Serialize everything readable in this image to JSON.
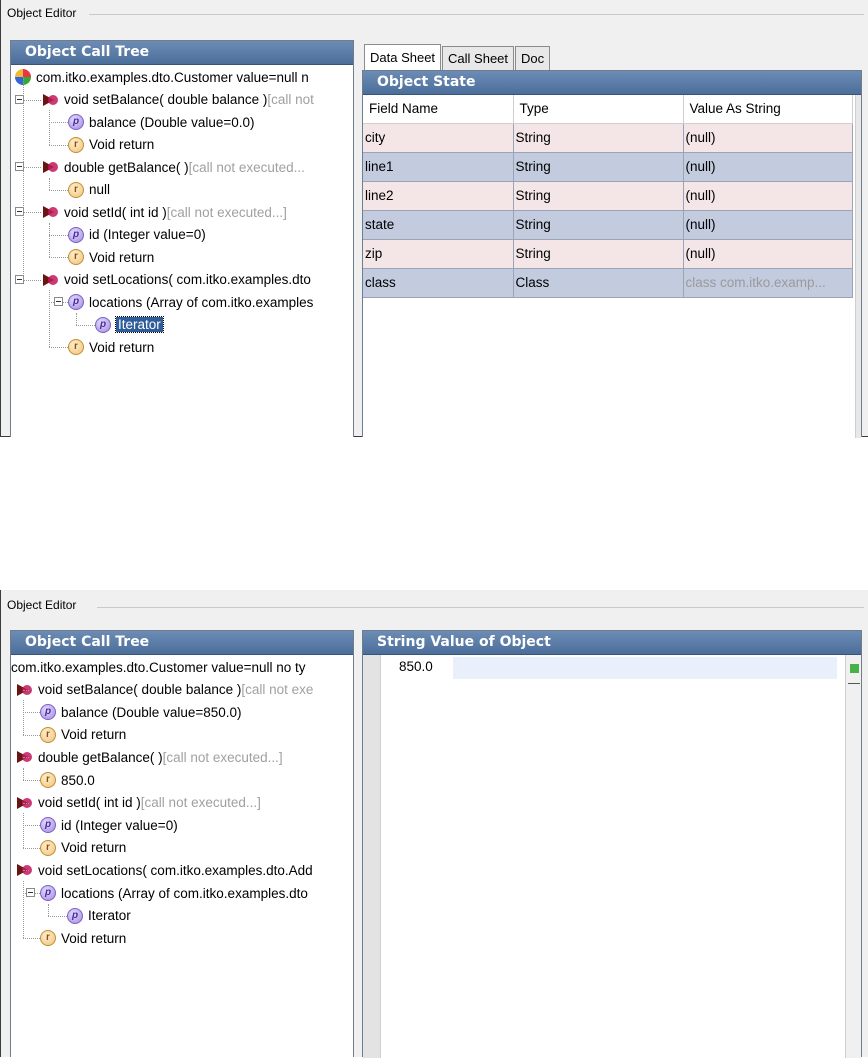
{
  "panel1": {
    "editor_title": "Object Editor",
    "tree_header": "Object Call Tree",
    "tree": [
      {
        "icon": "root",
        "text": "com.itko.examples.dto.Customer value=null n",
        "muted": ""
      },
      {
        "icon": "method",
        "text": "void setBalance( double balance ) ",
        "muted": "[call not"
      },
      {
        "icon": "param",
        "text": "balance (Double value=0.0)",
        "muted": ""
      },
      {
        "icon": "return",
        "text": "Void return",
        "muted": ""
      },
      {
        "icon": "method",
        "text": "double getBalance( ) ",
        "muted": "[call not executed..."
      },
      {
        "icon": "return",
        "text": "null",
        "muted": ""
      },
      {
        "icon": "method",
        "text": "void setId( int id ) ",
        "muted": "[call not executed...]"
      },
      {
        "icon": "param",
        "text": "id (Integer value=0)",
        "muted": ""
      },
      {
        "icon": "return",
        "text": "Void return",
        "muted": ""
      },
      {
        "icon": "method",
        "text": "void setLocations( com.itko.examples.dto",
        "muted": ""
      },
      {
        "icon": "param",
        "text": "locations (Array of com.itko.examples",
        "muted": ""
      },
      {
        "icon": "param",
        "text": "Iterator",
        "muted": "",
        "selected": true
      },
      {
        "icon": "return",
        "text": "Void return",
        "muted": ""
      }
    ],
    "tabs": [
      "Data Sheet",
      "Call Sheet",
      "Doc"
    ],
    "active_tab": "Data Sheet",
    "state_header": "Object State",
    "columns": [
      "Field Name",
      "Type",
      "Value As String"
    ],
    "rows": [
      [
        "city",
        "String",
        "(null)"
      ],
      [
        "line1",
        "String",
        "(null)"
      ],
      [
        "line2",
        "String",
        "(null)"
      ],
      [
        "state",
        "String",
        "(null)"
      ],
      [
        "zip",
        "String",
        "(null)"
      ],
      [
        "class",
        "Class",
        "class com.itko.examp..."
      ]
    ]
  },
  "panel2": {
    "editor_title": "Object Editor",
    "tree_header": "Object Call Tree",
    "tree": [
      {
        "icon": "none",
        "text": "com.itko.examples.dto.Customer value=null no ty",
        "muted": ""
      },
      {
        "icon": "method",
        "text": "void setBalance( double balance ) ",
        "muted": "[call not exe"
      },
      {
        "icon": "param",
        "text": "balance (Double value=850.0)",
        "muted": ""
      },
      {
        "icon": "return",
        "text": "Void return",
        "muted": ""
      },
      {
        "icon": "method",
        "text": "double getBalance( ) ",
        "muted": "[call not executed...]"
      },
      {
        "icon": "return",
        "text": "850.0",
        "muted": ""
      },
      {
        "icon": "method",
        "text": "void setId( int id ) ",
        "muted": "[call not executed...]"
      },
      {
        "icon": "param",
        "text": "id (Integer value=0)",
        "muted": ""
      },
      {
        "icon": "return",
        "text": "Void return",
        "muted": ""
      },
      {
        "icon": "method",
        "text": "void setLocations( com.itko.examples.dto.Add",
        "muted": ""
      },
      {
        "icon": "param",
        "text": "locations (Array of com.itko.examples.dto",
        "muted": ""
      },
      {
        "icon": "param",
        "text": "Iterator",
        "muted": ""
      },
      {
        "icon": "return",
        "text": "Void return",
        "muted": ""
      }
    ],
    "value_header": "String Value of Object",
    "value_text": "850.0"
  }
}
